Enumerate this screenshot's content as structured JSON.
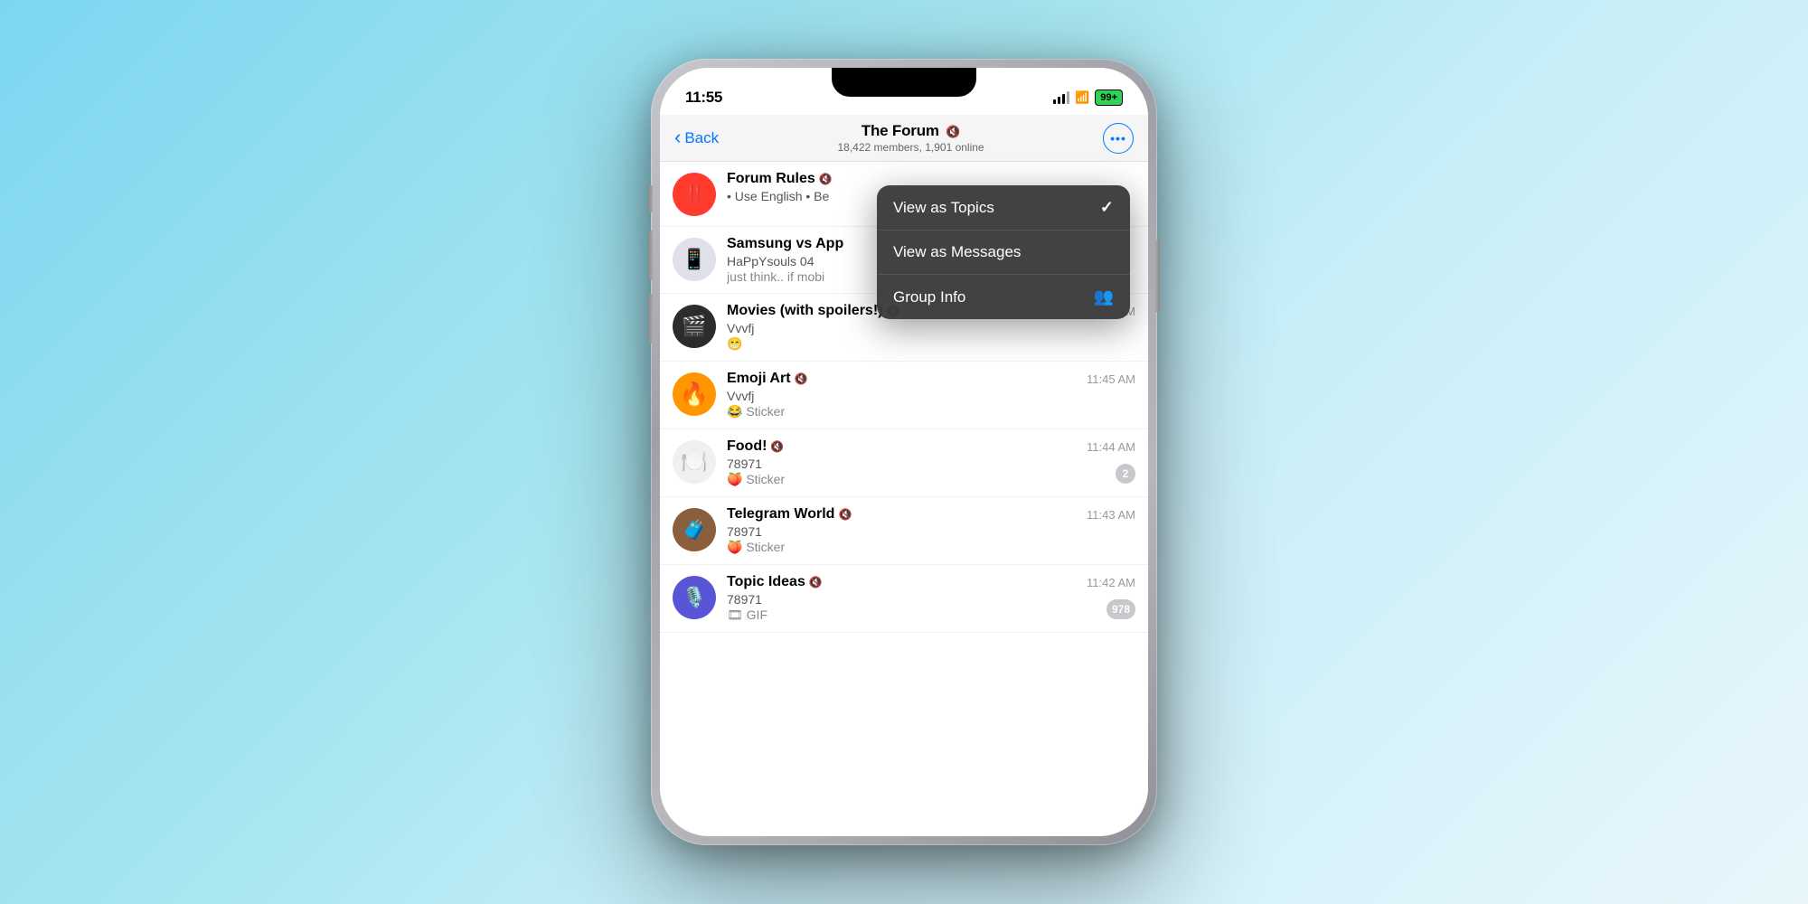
{
  "phone": {
    "status_bar": {
      "time": "11:55",
      "battery": "99+"
    },
    "nav": {
      "back_label": "Back",
      "title": "The Forum",
      "subtitle": "18,422 members, 1,901 online",
      "more_icon": "•••"
    },
    "topics": [
      {
        "id": "forum-rules",
        "icon_emoji": "‼️",
        "icon_class": "red-icon",
        "name": "Forum Rules",
        "muted": true,
        "time": "",
        "sender": "• Use English • Be",
        "message": "",
        "badge": null
      },
      {
        "id": "samsung-vs-apple",
        "icon_emoji": "📱",
        "icon_class": "phone-icon",
        "name": "Samsung vs App",
        "muted": false,
        "time": "",
        "sender": "HaPpYsouls 04",
        "message": "just think.. if mobi",
        "badge": null
      },
      {
        "id": "movies",
        "icon_emoji": "🎬",
        "icon_class": "movie-icon",
        "name": "Movies (with spoilers!)",
        "muted": true,
        "time": "11:49 AM",
        "sender": "Vvvfj",
        "message": "😁",
        "badge": null
      },
      {
        "id": "emoji-art",
        "icon_emoji": "🔥",
        "icon_class": "fire-icon",
        "name": "Emoji Art",
        "muted": true,
        "time": "11:45 AM",
        "sender": "Vvvfj",
        "message": "😂 Sticker",
        "badge": null
      },
      {
        "id": "food",
        "icon_emoji": "🍽️",
        "icon_class": "food-icon",
        "name": "Food!",
        "muted": true,
        "time": "11:44 AM",
        "sender": "78971",
        "message": "🍑 Sticker",
        "badge": "2"
      },
      {
        "id": "telegram-world",
        "icon_emoji": "🧳",
        "icon_class": "travel-icon",
        "name": "Telegram World",
        "muted": true,
        "time": "11:43 AM",
        "sender": "78971",
        "message": "🍑 Sticker",
        "badge": null
      },
      {
        "id": "topic-ideas",
        "icon_emoji": "🎙️",
        "icon_class": "idea-icon",
        "name": "Topic Ideas",
        "muted": true,
        "time": "11:42 AM",
        "sender": "78971",
        "message": "🎞 GIF",
        "badge": "978"
      }
    ],
    "context_menu": {
      "items": [
        {
          "id": "view-as-topics",
          "label": "View as Topics",
          "icon": "✓",
          "icon_type": "check"
        },
        {
          "id": "view-as-messages",
          "label": "View as Messages",
          "icon": "",
          "icon_type": "none"
        },
        {
          "id": "group-info",
          "label": "Group Info",
          "icon": "👥",
          "icon_type": "group"
        }
      ]
    }
  }
}
